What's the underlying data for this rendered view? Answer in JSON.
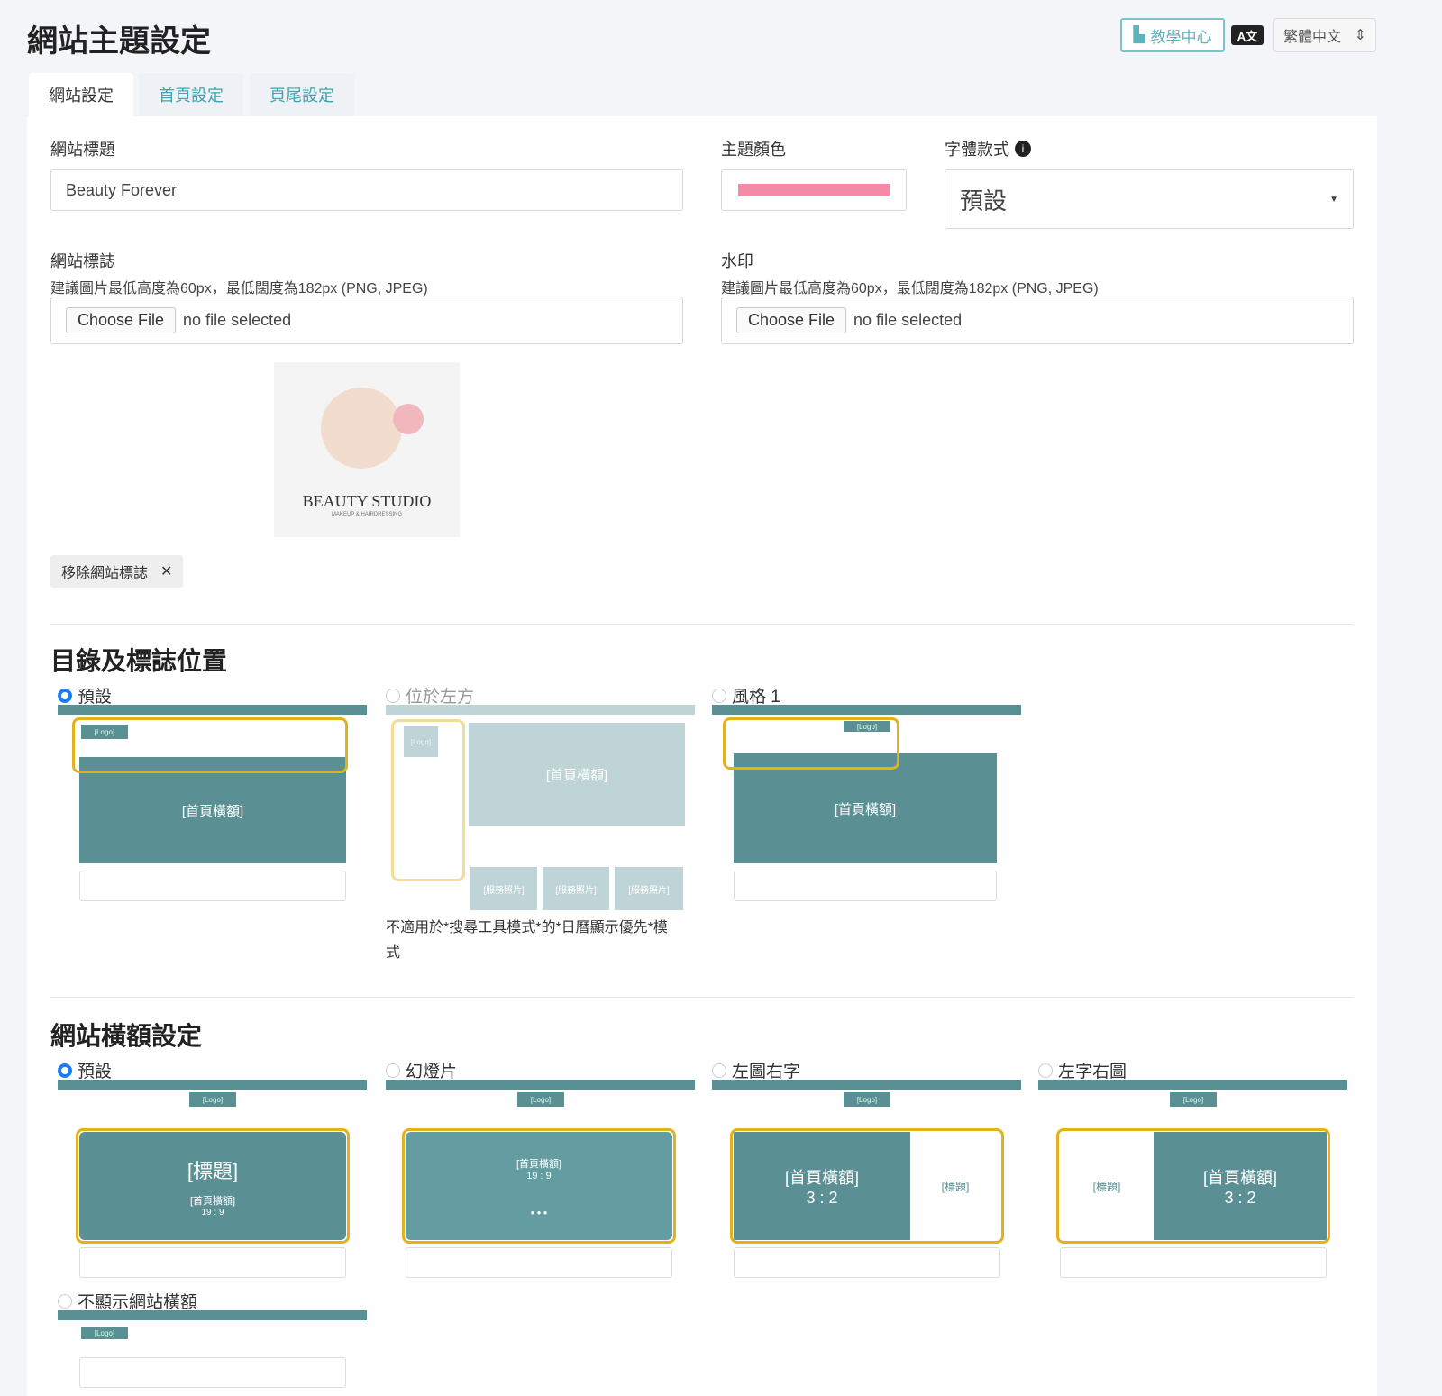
{
  "header": {
    "title": "網站主題設定",
    "help_label": "教學中心",
    "translate_icon": "A文",
    "language": "繁體中文"
  },
  "tabs": [
    {
      "label": "網站設定",
      "active": true
    },
    {
      "label": "首頁設定"
    },
    {
      "label": "頁尾設定"
    }
  ],
  "form": {
    "site_title_label": "網站標題",
    "site_title_value": "Beauty Forever",
    "theme_color_label": "主題顏色",
    "theme_color": "#f48aa7",
    "font_label": "字體款式",
    "font_value": "預設",
    "logo_label": "網站標誌",
    "logo_hint": "建議圖片最低高度為60px，最低闊度為182px (PNG, JPEG)",
    "watermark_label": "水印",
    "watermark_hint": "建議圖片最低高度為60px，最低闊度為182px (PNG, JPEG)",
    "choose_file": "Choose File",
    "no_file": "no file selected",
    "logo_preview_text": "BEAUTY STUDIO",
    "logo_preview_sub": "MAKEUP & HAIRDRESSING",
    "remove_logo": "移除網站標誌"
  },
  "menu_position": {
    "title": "目錄及標誌位置",
    "options": [
      {
        "label": "預設",
        "selected": true
      },
      {
        "label": "位於左方",
        "disabled": true
      },
      {
        "label": "風格 1"
      }
    ],
    "note": "不適用於*搜尋工具模式*的*日曆顯示優先*模式"
  },
  "banner": {
    "title": "網站橫額設定",
    "options": [
      {
        "label": "預設",
        "selected": true
      },
      {
        "label": "幻燈片"
      },
      {
        "label": "左圖右字"
      },
      {
        "label": "左字右圖"
      },
      {
        "label": "不顯示網站橫額"
      }
    ]
  },
  "thumb_text": {
    "logo": "[Logo]",
    "banner": "[首頁橫額]",
    "heading": "[標題]",
    "r199": "19 : 9",
    "r32": "3 : 2",
    "photo": "[服務照片]"
  },
  "colors": {
    "teal": "#5a8f94",
    "highlight": "#e2b21d",
    "accent": "#3aa6b0"
  }
}
